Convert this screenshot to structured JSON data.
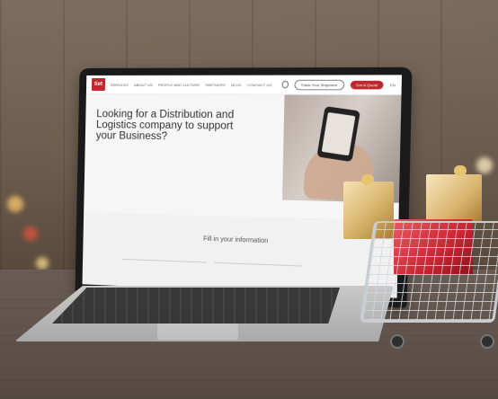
{
  "site": {
    "logo_text": "tiet",
    "nav_items": [
      "SERVICES",
      "ABOUT US",
      "PEOPLE AND CULTURE",
      "PARTNERS",
      "BLOG",
      "CONTACT US"
    ],
    "buttons": {
      "outline": "Track Your Shipment",
      "primary": "Get A Quote"
    },
    "language_text": "EN"
  },
  "hero": {
    "title": "Looking for a Distribution and Logistics company to support your Business?"
  },
  "form": {
    "title": "Fill in your information"
  },
  "colors": {
    "brand": "#c0282f"
  }
}
